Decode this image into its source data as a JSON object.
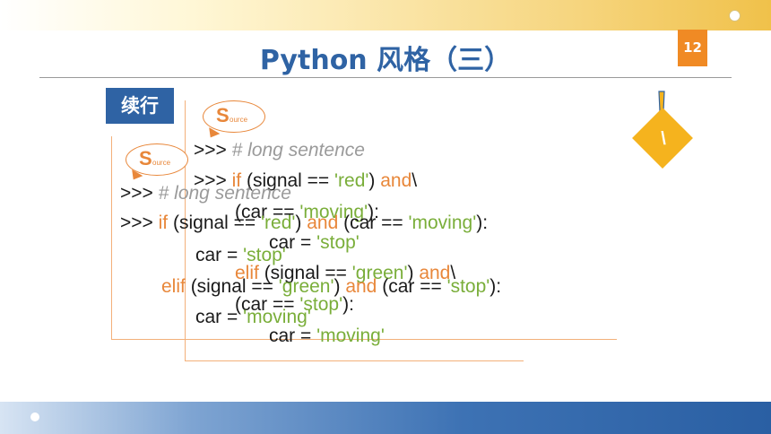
{
  "slide": {
    "title": "Python 风格（三）",
    "page_number": "12",
    "section_label": "续行",
    "tip_symbol": "\\"
  },
  "bubbles": [
    {
      "big": "S",
      "small": "ource"
    },
    {
      "big": "S",
      "small": "ource"
    }
  ],
  "back_code": {
    "line1_prompt": ">>> ",
    "line1_comment": "# long sentence",
    "line2_prompt": ">>> ",
    "line2_kw_if": "if",
    "line2_a": " (signal == ",
    "line2_str_red": "'red'",
    "line2_b": ") ",
    "line2_kw_and": "and",
    "line2_c": "\\",
    "line3_a": "(car == ",
    "line3_str": "'moving'",
    "line3_b": "):",
    "line4_a": "car = ",
    "line4_str": "'stop'",
    "line5_kw_elif": "elif",
    "line5_a": " (signal == ",
    "line5_str": "'green'",
    "line5_b": ") ",
    "line5_kw_and": "and",
    "line5_c": "\\",
    "line6_a": "(car == ",
    "line6_str": "'stop'",
    "line6_b": "):",
    "line7_a": "car = ",
    "line7_str": "'moving'"
  },
  "front_code": {
    "line1_prompt": ">>> ",
    "line1_comment": "# long sentence",
    "line2_prompt": ">>> ",
    "line2_kw_if": "if",
    "line2_a": " (signal == ",
    "line2_str_red": "'red'",
    "line2_b": ") ",
    "line2_kw_and": "and",
    "line2_c": " (car == ",
    "line2_str_moving": "'moving'",
    "line2_d": "):",
    "line3_a": "car = ",
    "line3_str": "'stop'",
    "line4_kw_elif": "elif",
    "line4_a": " (signal == ",
    "line4_str_green": "'green'",
    "line4_b": ") ",
    "line4_kw_and": "and",
    "line4_c": " (car == ",
    "line4_str_stop": "'stop'",
    "line4_d": "):",
    "line5_a": "car = ",
    "line5_str": "'moving'"
  },
  "colors": {
    "title": "#2f63a4",
    "accent_orange": "#e8873a",
    "string_green": "#7aae3a",
    "comment_gray": "#9a9a9a"
  },
  "icons": [
    "exclamation-icon",
    "diamond-tip-icon"
  ]
}
